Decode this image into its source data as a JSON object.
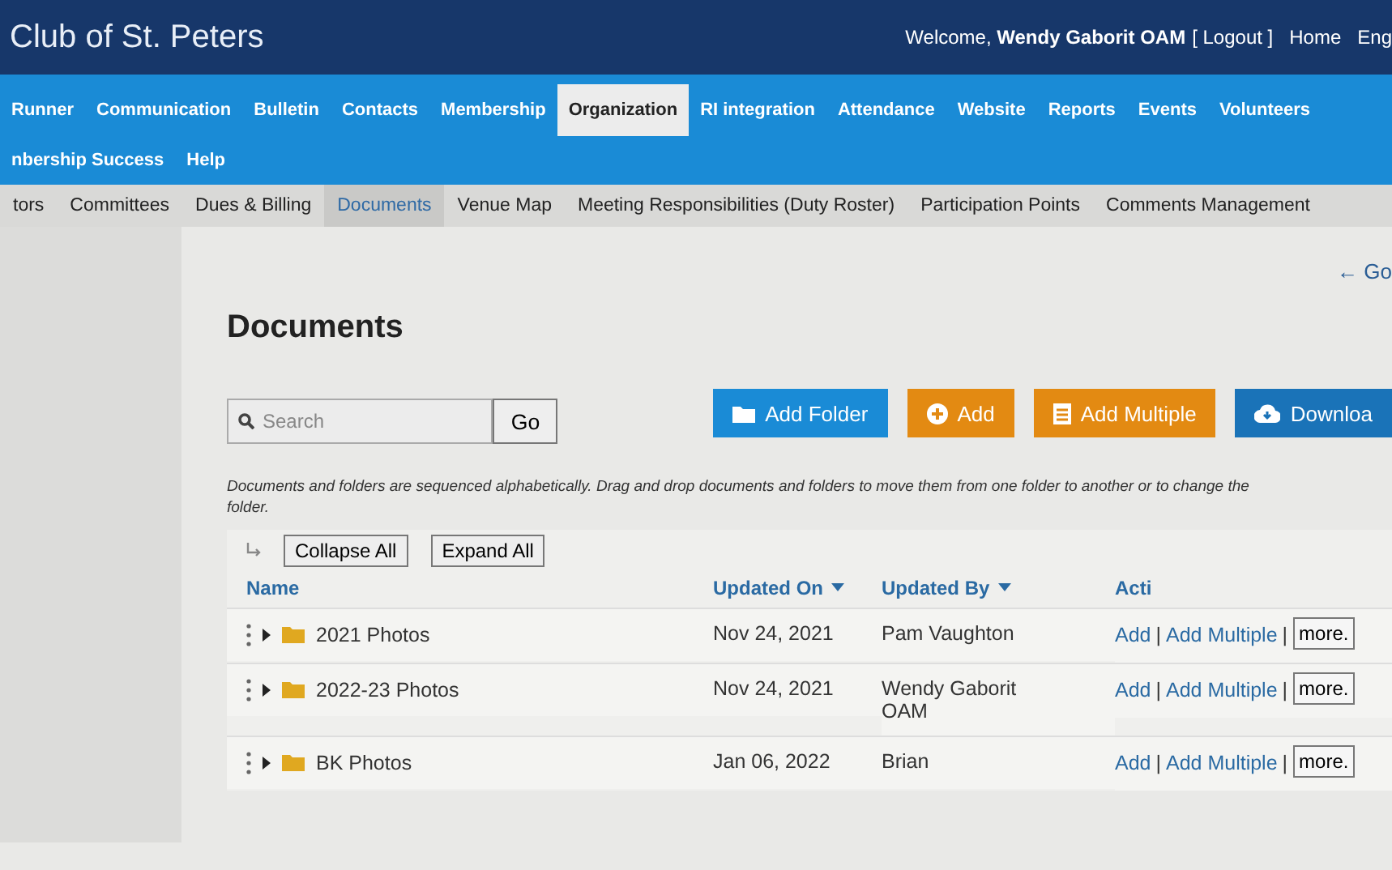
{
  "header": {
    "club_name": "Club of St. Peters",
    "welcome": "Welcome, **Wendy Gaborit OAM**",
    "logout": "[ Logout ]",
    "links": [
      "Home",
      "Eng"
    ]
  },
  "main_nav": [
    {
      "label": "Runner",
      "selected": false
    },
    {
      "label": "Communication",
      "selected": false
    },
    {
      "label": "Bulletin",
      "selected": false
    },
    {
      "label": "Contacts",
      "selected": false
    },
    {
      "label": "Membership",
      "selected": false
    },
    {
      "label": "Organization",
      "selected": true
    },
    {
      "label": "RI integration",
      "selected": false
    },
    {
      "label": "Attendance",
      "selected": false
    },
    {
      "label": "Website",
      "selected": false
    },
    {
      "label": "Reports",
      "selected": false
    },
    {
      "label": "Events",
      "selected": false
    },
    {
      "label": "Volunteers",
      "selected": false
    },
    {
      "label": "nbership Success",
      "selected": false
    },
    {
      "label": "Help",
      "selected": false
    }
  ],
  "sub_nav": [
    {
      "label": "tors",
      "selected": false
    },
    {
      "label": "Committees",
      "selected": false
    },
    {
      "label": "Dues & Billing",
      "selected": false
    },
    {
      "label": "Documents",
      "selected": true
    },
    {
      "label": "Venue Map",
      "selected": false
    },
    {
      "label": "Meeting Responsibilities (Duty Roster)",
      "selected": false
    },
    {
      "label": "Participation Points",
      "selected": false
    },
    {
      "label": "Comments Management",
      "selected": false
    }
  ],
  "back_link": "← Go",
  "page_title": "Documents",
  "search": {
    "placeholder": "Search",
    "button": "Go"
  },
  "actions": [
    {
      "kind": "folder",
      "label": "Add Folder"
    },
    {
      "kind": "add",
      "label": "Add"
    },
    {
      "kind": "multiple",
      "label": "Add Multiple"
    },
    {
      "kind": "download",
      "label": "Downloa"
    }
  ],
  "note": "Documents and folders are sequenced alphabetically. Drag and drop documents and folders to move them from one folder to another or to change the",
  "note_line_2": "folder.",
  "tree_buttons": [
    "Collapse All",
    "Expand All"
  ],
  "table": {
    "columns": [
      {
        "label": "Name",
        "sortable": false
      },
      {
        "label": "Updated On",
        "sortable": true
      },
      {
        "label": "Updated By",
        "sortable": true
      },
      {
        "label": "Acti",
        "sortable": false
      }
    ],
    "rows": [
      {
        "name": "2021 Photos",
        "updated_on": "Nov 24, 2021",
        "updated_by": "Pam Vaughton",
        "actions": [
          {
            "kind": "link",
            "text": "Add"
          },
          {
            "kind": "sep",
            "text": "|"
          },
          {
            "kind": "link",
            "text": "Add Multiple"
          },
          {
            "kind": "sep",
            "text": "|"
          },
          {
            "kind": "button",
            "text": "more."
          }
        ]
      },
      {
        "name": "2022-23 Photos",
        "updated_on": "Nov 24, 2021",
        "updated_by": "Wendy Gaborit OAM",
        "actions": [
          {
            "kind": "link",
            "text": "Add"
          },
          {
            "kind": "sep",
            "text": "|"
          },
          {
            "kind": "link",
            "text": "Add Multiple"
          },
          {
            "kind": "sep",
            "text": "|"
          },
          {
            "kind": "button",
            "text": "more."
          }
        ]
      },
      {
        "name": "BK Photos",
        "updated_on": "Jan 06, 2022",
        "updated_by": "Brian",
        "actions": [
          {
            "kind": "link",
            "text": "Add"
          },
          {
            "kind": "sep",
            "text": "|"
          },
          {
            "kind": "link",
            "text": "Add Multiple"
          },
          {
            "kind": "sep",
            "text": "|"
          },
          {
            "kind": "button",
            "text": "more."
          }
        ]
      }
    ]
  }
}
